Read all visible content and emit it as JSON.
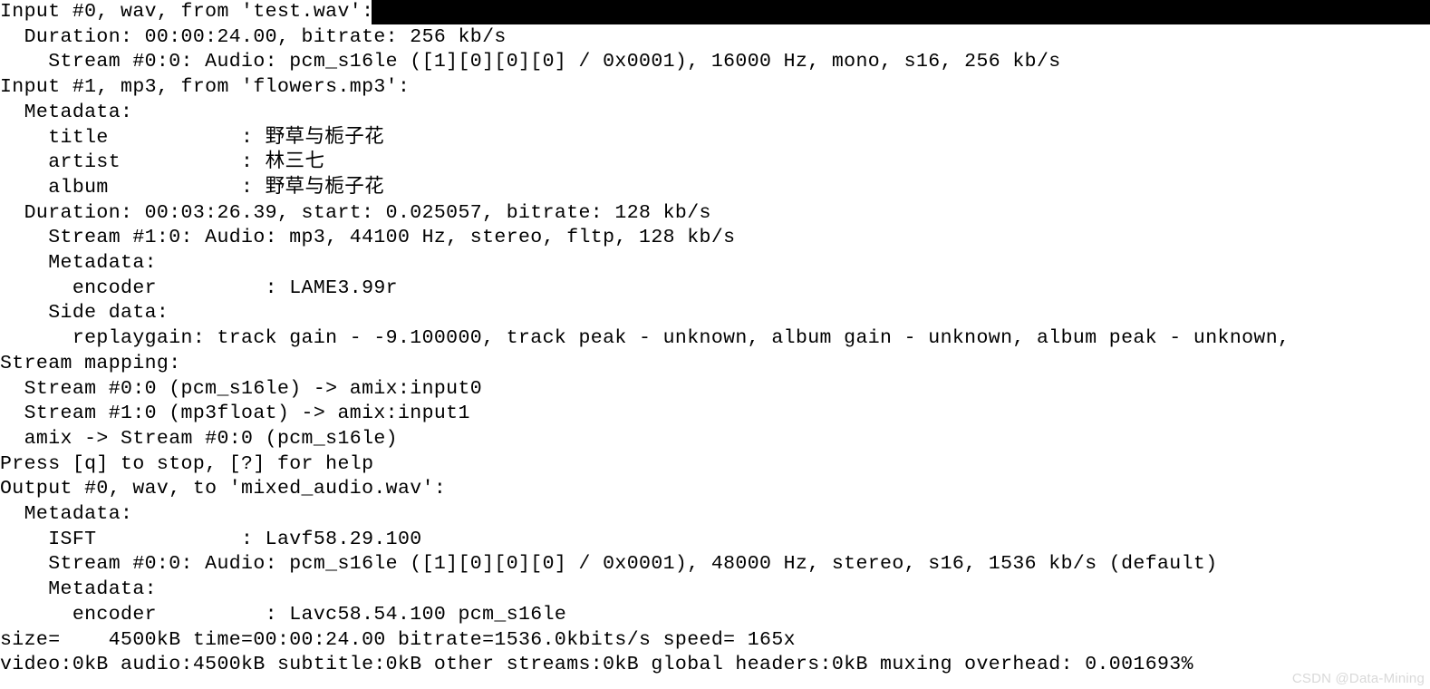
{
  "lines": [
    {
      "prefix": "Input #0, wav, from 'test.wav':",
      "bar": true
    },
    {
      "text": "  Duration: 00:00:24.00, bitrate: 256 kb/s"
    },
    {
      "text": "    Stream #0:0: Audio: pcm_s16le ([1][0][0][0] / 0x0001), 16000 Hz, mono, s16, 256 kb/s"
    },
    {
      "text": "Input #1, mp3, from 'flowers.mp3':"
    },
    {
      "text": "  Metadata:"
    },
    {
      "text": "    title           : 野草与栀子花"
    },
    {
      "text": "    artist          : 林三七"
    },
    {
      "text": "    album           : 野草与栀子花"
    },
    {
      "text": "  Duration: 00:03:26.39, start: 0.025057, bitrate: 128 kb/s"
    },
    {
      "text": "    Stream #1:0: Audio: mp3, 44100 Hz, stereo, fltp, 128 kb/s"
    },
    {
      "text": "    Metadata:"
    },
    {
      "text": "      encoder         : LAME3.99r"
    },
    {
      "text": "    Side data:"
    },
    {
      "text": "      replaygain: track gain - -9.100000, track peak - unknown, album gain - unknown, album peak - unknown, "
    },
    {
      "text": "Stream mapping:"
    },
    {
      "text": "  Stream #0:0 (pcm_s16le) -> amix:input0"
    },
    {
      "text": "  Stream #1:0 (mp3float) -> amix:input1"
    },
    {
      "text": "  amix -> Stream #0:0 (pcm_s16le)"
    },
    {
      "text": "Press [q] to stop, [?] for help"
    },
    {
      "text": "Output #0, wav, to 'mixed_audio.wav':"
    },
    {
      "text": "  Metadata:"
    },
    {
      "text": "    ISFT            : Lavf58.29.100"
    },
    {
      "text": "    Stream #0:0: Audio: pcm_s16le ([1][0][0][0] / 0x0001), 48000 Hz, stereo, s16, 1536 kb/s (default)"
    },
    {
      "text": "    Metadata:"
    },
    {
      "text": "      encoder         : Lavc58.54.100 pcm_s16le"
    },
    {
      "text": "size=    4500kB time=00:00:24.00 bitrate=1536.0kbits/s speed= 165x    "
    },
    {
      "text": "video:0kB audio:4500kB subtitle:0kB other streams:0kB global headers:0kB muxing overhead: 0.001693%"
    }
  ],
  "watermark": "CSDN @Data-Mining"
}
